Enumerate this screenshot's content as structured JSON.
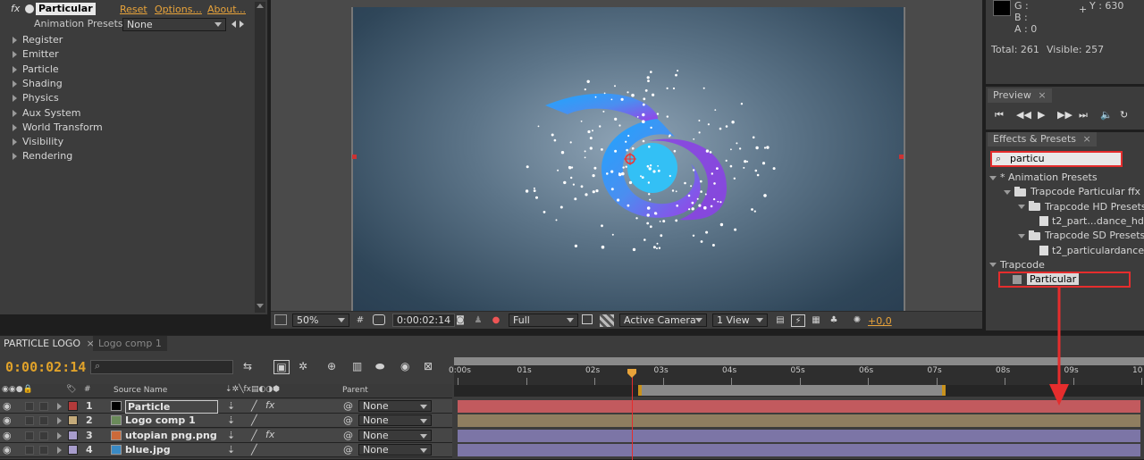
{
  "effect_controls": {
    "fx_label": "fx",
    "effect_name": "Particular",
    "reset": "Reset",
    "options": "Options...",
    "about": "About...",
    "presets_label": "Animation Presets:",
    "presets_value": "None",
    "groups": [
      "Register",
      "Emitter",
      "Particle",
      "Shading",
      "Physics",
      "Aux System",
      "World Transform",
      "Visibility",
      "Rendering"
    ]
  },
  "viewer": {
    "zoom": "50%",
    "timecode": "0:00:02:14",
    "resolution": "Full",
    "camera": "Active Camera",
    "views": "1 View",
    "exposure": "+0,0"
  },
  "info": {
    "g": "G :",
    "b": "B :",
    "a": "A : 0",
    "y": "Y : 630",
    "total": "Total: 261",
    "visible": "Visible: 257"
  },
  "preview": {
    "title": "Preview"
  },
  "effects_presets": {
    "title": "Effects & Presets",
    "search": "particu",
    "tree": [
      {
        "label": "* Animation Presets",
        "kind": "root"
      },
      {
        "label": "Trapcode Particular ffx",
        "kind": "folder"
      },
      {
        "label": "Trapcode HD Presets",
        "kind": "folder"
      },
      {
        "label": "t2_part...dance_hd",
        "kind": "preset"
      },
      {
        "label": "Trapcode SD Presets",
        "kind": "folder"
      },
      {
        "label": "t2_particulardance",
        "kind": "preset"
      },
      {
        "label": "Trapcode",
        "kind": "root"
      },
      {
        "label": "Particular",
        "kind": "effect"
      }
    ]
  },
  "timeline": {
    "tabs": [
      "PARTICLE LOGO",
      "Logo comp 1"
    ],
    "timecode": "0:00:02:14",
    "ruler": [
      "0:00s",
      "01s",
      "02s",
      "03s",
      "04s",
      "05s",
      "06s",
      "07s",
      "08s",
      "09s",
      "10"
    ],
    "col_source": "Source Name",
    "col_parent": "Parent",
    "layers": [
      {
        "num": "1",
        "name": "Particle",
        "parent": "None",
        "color": "#b33a3a",
        "fx": true,
        "bar_color": "#c25a5e"
      },
      {
        "num": "2",
        "name": "Logo comp 1",
        "parent": "None",
        "color": "#c4aa7a",
        "fx": false,
        "bar_color": "#8f7e60"
      },
      {
        "num": "3",
        "name": "utopian png.png",
        "parent": "None",
        "color": "#a79ccb",
        "fx": true,
        "bar_color": "#7c75a6"
      },
      {
        "num": "4",
        "name": "blue.jpg",
        "parent": "None",
        "color": "#a79ccb",
        "fx": false,
        "bar_color": "#7c75a6"
      }
    ]
  },
  "colors": {
    "accent": "#e8a33a",
    "highlight": "#e52d2d",
    "timecode": "#e0a22a"
  }
}
